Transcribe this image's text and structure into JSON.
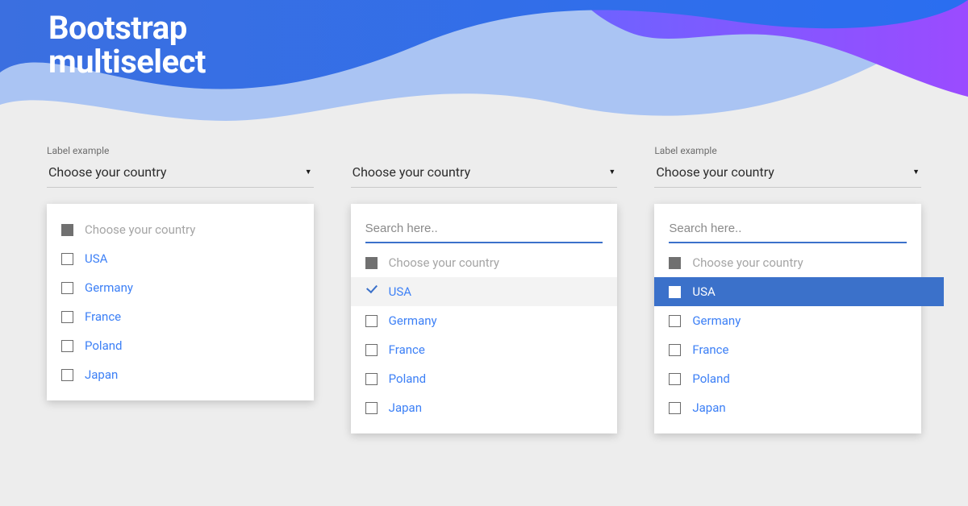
{
  "title_line1": "Bootstrap",
  "title_line2": "multiselect",
  "label_text": "Label example",
  "trigger_text": "Choose your country",
  "placeholder_option": "Choose your country",
  "search_placeholder": "Search here..",
  "countries": {
    "usa": "USA",
    "germany": "Germany",
    "france": "France",
    "poland": "Poland",
    "japan": "Japan"
  }
}
